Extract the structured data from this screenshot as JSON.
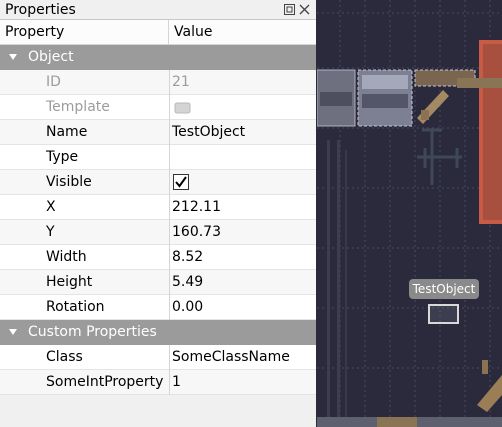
{
  "panel": {
    "title": "Properties"
  },
  "table": {
    "headers": {
      "property": "Property",
      "value": "Value"
    },
    "groups": {
      "object": "Object",
      "custom": "Custom Properties"
    },
    "rows": [
      {
        "name": "ID",
        "value": "21",
        "disabled": true
      },
      {
        "name": "Template",
        "value": "",
        "disabled": true
      },
      {
        "name": "Name",
        "value": "TestObject"
      },
      {
        "name": "Type",
        "value": ""
      },
      {
        "name": "Visible",
        "value": "",
        "checked": true
      },
      {
        "name": "X",
        "value": "212.11"
      },
      {
        "name": "Y",
        "value": "160.73"
      },
      {
        "name": "Width",
        "value": "8.52"
      },
      {
        "name": "Height",
        "value": "5.49"
      },
      {
        "name": "Rotation",
        "value": "0.00"
      }
    ],
    "custom_rows": [
      {
        "name": "Class",
        "value": "SomeClassName"
      },
      {
        "name": "SomeIntProperty",
        "value": "1"
      }
    ]
  },
  "canvas": {
    "object_label": "TestObject"
  }
}
